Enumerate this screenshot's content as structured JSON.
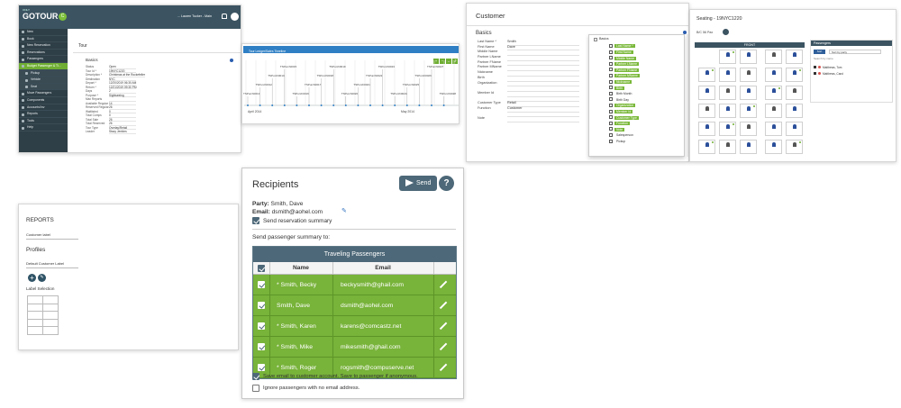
{
  "gotour": {
    "logo_sub": "ONLY",
    "logo": "GOTOUR",
    "badge": "C",
    "user": "... Lauren Tucker - Main",
    "nav": [
      {
        "label": "New",
        "active": false,
        "sub": false
      },
      {
        "label": "Book",
        "active": false,
        "sub": false
      },
      {
        "label": "New Reservation",
        "active": false,
        "sub": false
      },
      {
        "label": "Reservations",
        "active": false,
        "sub": false
      },
      {
        "label": "Passengers",
        "active": false,
        "sub": false
      },
      {
        "label": "Budget Passenger & Ti...",
        "active": true,
        "sub": false
      },
      {
        "label": "Pickup",
        "active": false,
        "sub": true
      },
      {
        "label": "Vehicle",
        "active": false,
        "sub": true
      },
      {
        "label": "Seat",
        "active": false,
        "sub": true
      },
      {
        "label": "Move Passengers",
        "active": false,
        "sub": false
      },
      {
        "label": "Components",
        "active": false,
        "sub": false
      },
      {
        "label": "Accounts/Inv",
        "active": false,
        "sub": false
      },
      {
        "label": "Reports",
        "active": false,
        "sub": false
      },
      {
        "label": "Tools",
        "active": false,
        "sub": false
      },
      {
        "label": "Help",
        "active": false,
        "sub": false
      }
    ],
    "tab": "Tour",
    "section": "Basics",
    "fields": [
      {
        "label": "Status",
        "value": "Open"
      },
      {
        "label": "Tour Id *",
        "value": "19NYC1220"
      },
      {
        "label": "Description *",
        "value": "Christmas at the Rockefeller"
      },
      {
        "label": "Destination",
        "value": "NYC"
      },
      {
        "label": "Depart *",
        "value": "12/20/2019 06:30 AM"
      },
      {
        "label": "Return *",
        "value": "12/21/2019 09:30 PM"
      },
      {
        "label": "Days",
        "value": "2"
      },
      {
        "label": "Purpose *",
        "value": "Sightseeing"
      },
      {
        "label": "Max Reports",
        "value": ""
      },
      {
        "label": "Available Regular",
        "value": "14"
      },
      {
        "label": "Reserved Regular",
        "value": "26"
      },
      {
        "label": "Waitlisted",
        "value": "0"
      },
      {
        "label": "Total Comps",
        "value": "0"
      },
      {
        "label": "Total Sale",
        "value": "26"
      },
      {
        "label": "Total Reserved",
        "value": "26"
      },
      {
        "label": "Tour Type",
        "value": "Overlay/Retail"
      },
      {
        "label": "Leader",
        "value": "Stacy Jenkins"
      }
    ]
  },
  "chart": {
    "title": "Tour Ledger/Sales Timeline"
  },
  "chart_data": {
    "type": "line",
    "labels": [
      "TSPurch0013",
      "TSPurch0012",
      "TSPurch0014",
      "TSPurch0015",
      "TSPurch0016",
      "TSPurch0017",
      "TSPurch0018",
      "TSPurch0019",
      "TSPurch0020",
      "TSPurch0021",
      "TSPurch0022",
      "TSPurch0023",
      "TSPurch0024",
      "TSPurch0025",
      "TSPurch0026",
      "TSPurch0027",
      "TSPurch0028"
    ],
    "axis_labels": [
      "April 2014",
      "May 2014"
    ]
  },
  "customer": {
    "title": "Customer",
    "section": "Basics",
    "fields": [
      {
        "label": "Last Name *",
        "value": "Smith"
      },
      {
        "label": "First Name",
        "value": "Dave"
      },
      {
        "label": "Middle Name",
        "value": ""
      },
      {
        "label": "Partner LName",
        "value": ""
      },
      {
        "label": "Partner FName",
        "value": ""
      },
      {
        "label": "Partner MName",
        "value": ""
      },
      {
        "label": "Nickname",
        "value": ""
      },
      {
        "label": "Birth",
        "value": ""
      },
      {
        "label": "Organization",
        "value": ""
      },
      {
        "label": "",
        "value": ""
      },
      {
        "label": "Member Id",
        "value": ""
      },
      {
        "label": "",
        "value": ""
      },
      {
        "label": "Customer Type",
        "value": "Retail"
      },
      {
        "label": "Function",
        "value": "Customer"
      },
      {
        "label": "",
        "value": ""
      },
      {
        "label": "Note",
        "value": ""
      }
    ],
    "dropdown_head": "Basics",
    "options": [
      {
        "label": "Last Name *",
        "on": true
      },
      {
        "label": "First Name",
        "on": true
      },
      {
        "label": "Middle Name",
        "on": true
      },
      {
        "label": "Partner LName",
        "on": true
      },
      {
        "label": "Partner FName",
        "on": true
      },
      {
        "label": "Partner MName",
        "on": true
      },
      {
        "label": "Nickname",
        "on": true
      },
      {
        "label": "Birth",
        "on": true
      },
      {
        "label": "Birth Month",
        "on": false
      },
      {
        "label": "Birth Day",
        "on": false
      },
      {
        "label": "Organization",
        "on": true
      },
      {
        "label": "Member Id",
        "on": true
      },
      {
        "label": "Customer Type",
        "on": true
      },
      {
        "label": "Function",
        "on": true
      },
      {
        "label": "Note",
        "on": true
      },
      {
        "label": "Salesperson",
        "on": false
      },
      {
        "label": "Pickup",
        "on": false
      }
    ]
  },
  "seating": {
    "title": "Seating - 19NYC1220",
    "select": "B/C 56 Pax",
    "front": "FRONT",
    "passengers_head": "Passengers",
    "sort_button": "Sort",
    "sort_select": "Sort by party",
    "search": "Search by name",
    "passengers": [
      "Matthews, Tom",
      "Matthews, Carol"
    ]
  },
  "reports": {
    "title": "REPORTS",
    "customer_label": "Customer label",
    "profiles": "Profiles",
    "default_label": "Default Customer Label",
    "label_selection": "Label Selection"
  },
  "recipients": {
    "title": "Recipients",
    "send_label": "Send",
    "help": "?",
    "party_label": "Party:",
    "party_value": "Smith, Dave",
    "email_label": "Email:",
    "email_value": "dsmith@aohel.com",
    "send_summary": "Send reservation summary",
    "passenger_summary": "Send passenger summary to:",
    "table_title": "Traveling Passengers",
    "col_name": "Name",
    "col_email": "Email",
    "rows": [
      {
        "name": "* Smith, Becky",
        "email": "beckysmith@ghail.com"
      },
      {
        "name": "Smith, Dave",
        "email": "dsmith@aohel.com"
      },
      {
        "name": "* Smith, Karen",
        "email": "karens@comcastz.net"
      },
      {
        "name": "* Smith, Mike",
        "email": "mikesmith@ghail.com"
      },
      {
        "name": "* Smith, Roger",
        "email": "rogsmith@compuserve.net"
      }
    ],
    "save_email": "Save email to customer account. Save to passenger if anonymous.",
    "ignore": "Ignore passengers with no email address."
  }
}
